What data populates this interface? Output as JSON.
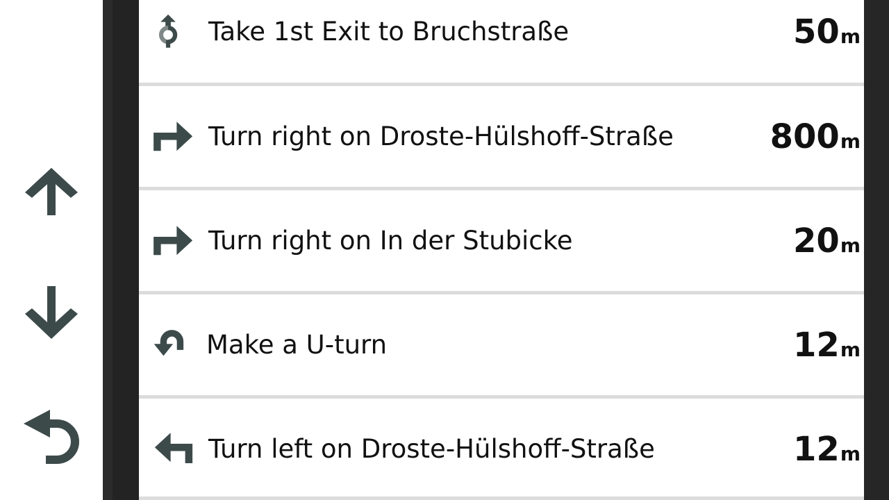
{
  "nav": {
    "up_icon": "arrow-up-icon",
    "down_icon": "arrow-down-icon",
    "back_icon": "back-icon"
  },
  "colors": {
    "icon": "#3d4a4a",
    "dark_frame": "#262626",
    "separator": "#dcdcdc"
  },
  "directions": [
    {
      "icon": "roundabout-first-exit-icon",
      "text": "Take 1st Exit to Bruchstraße",
      "distance": "50",
      "unit": "m"
    },
    {
      "icon": "turn-right-icon",
      "text": "Turn right on Droste-Hülshoff-Straße",
      "distance": "800",
      "unit": "m"
    },
    {
      "icon": "turn-right-icon",
      "text": "Turn right on In der Stubicke",
      "distance": "20",
      "unit": "m"
    },
    {
      "icon": "u-turn-icon",
      "text": "Make a U-turn",
      "distance": "12",
      "unit": "m"
    },
    {
      "icon": "turn-left-icon",
      "text": "Turn left on Droste-Hülshoff-Straße",
      "distance": "12",
      "unit": "m"
    }
  ]
}
